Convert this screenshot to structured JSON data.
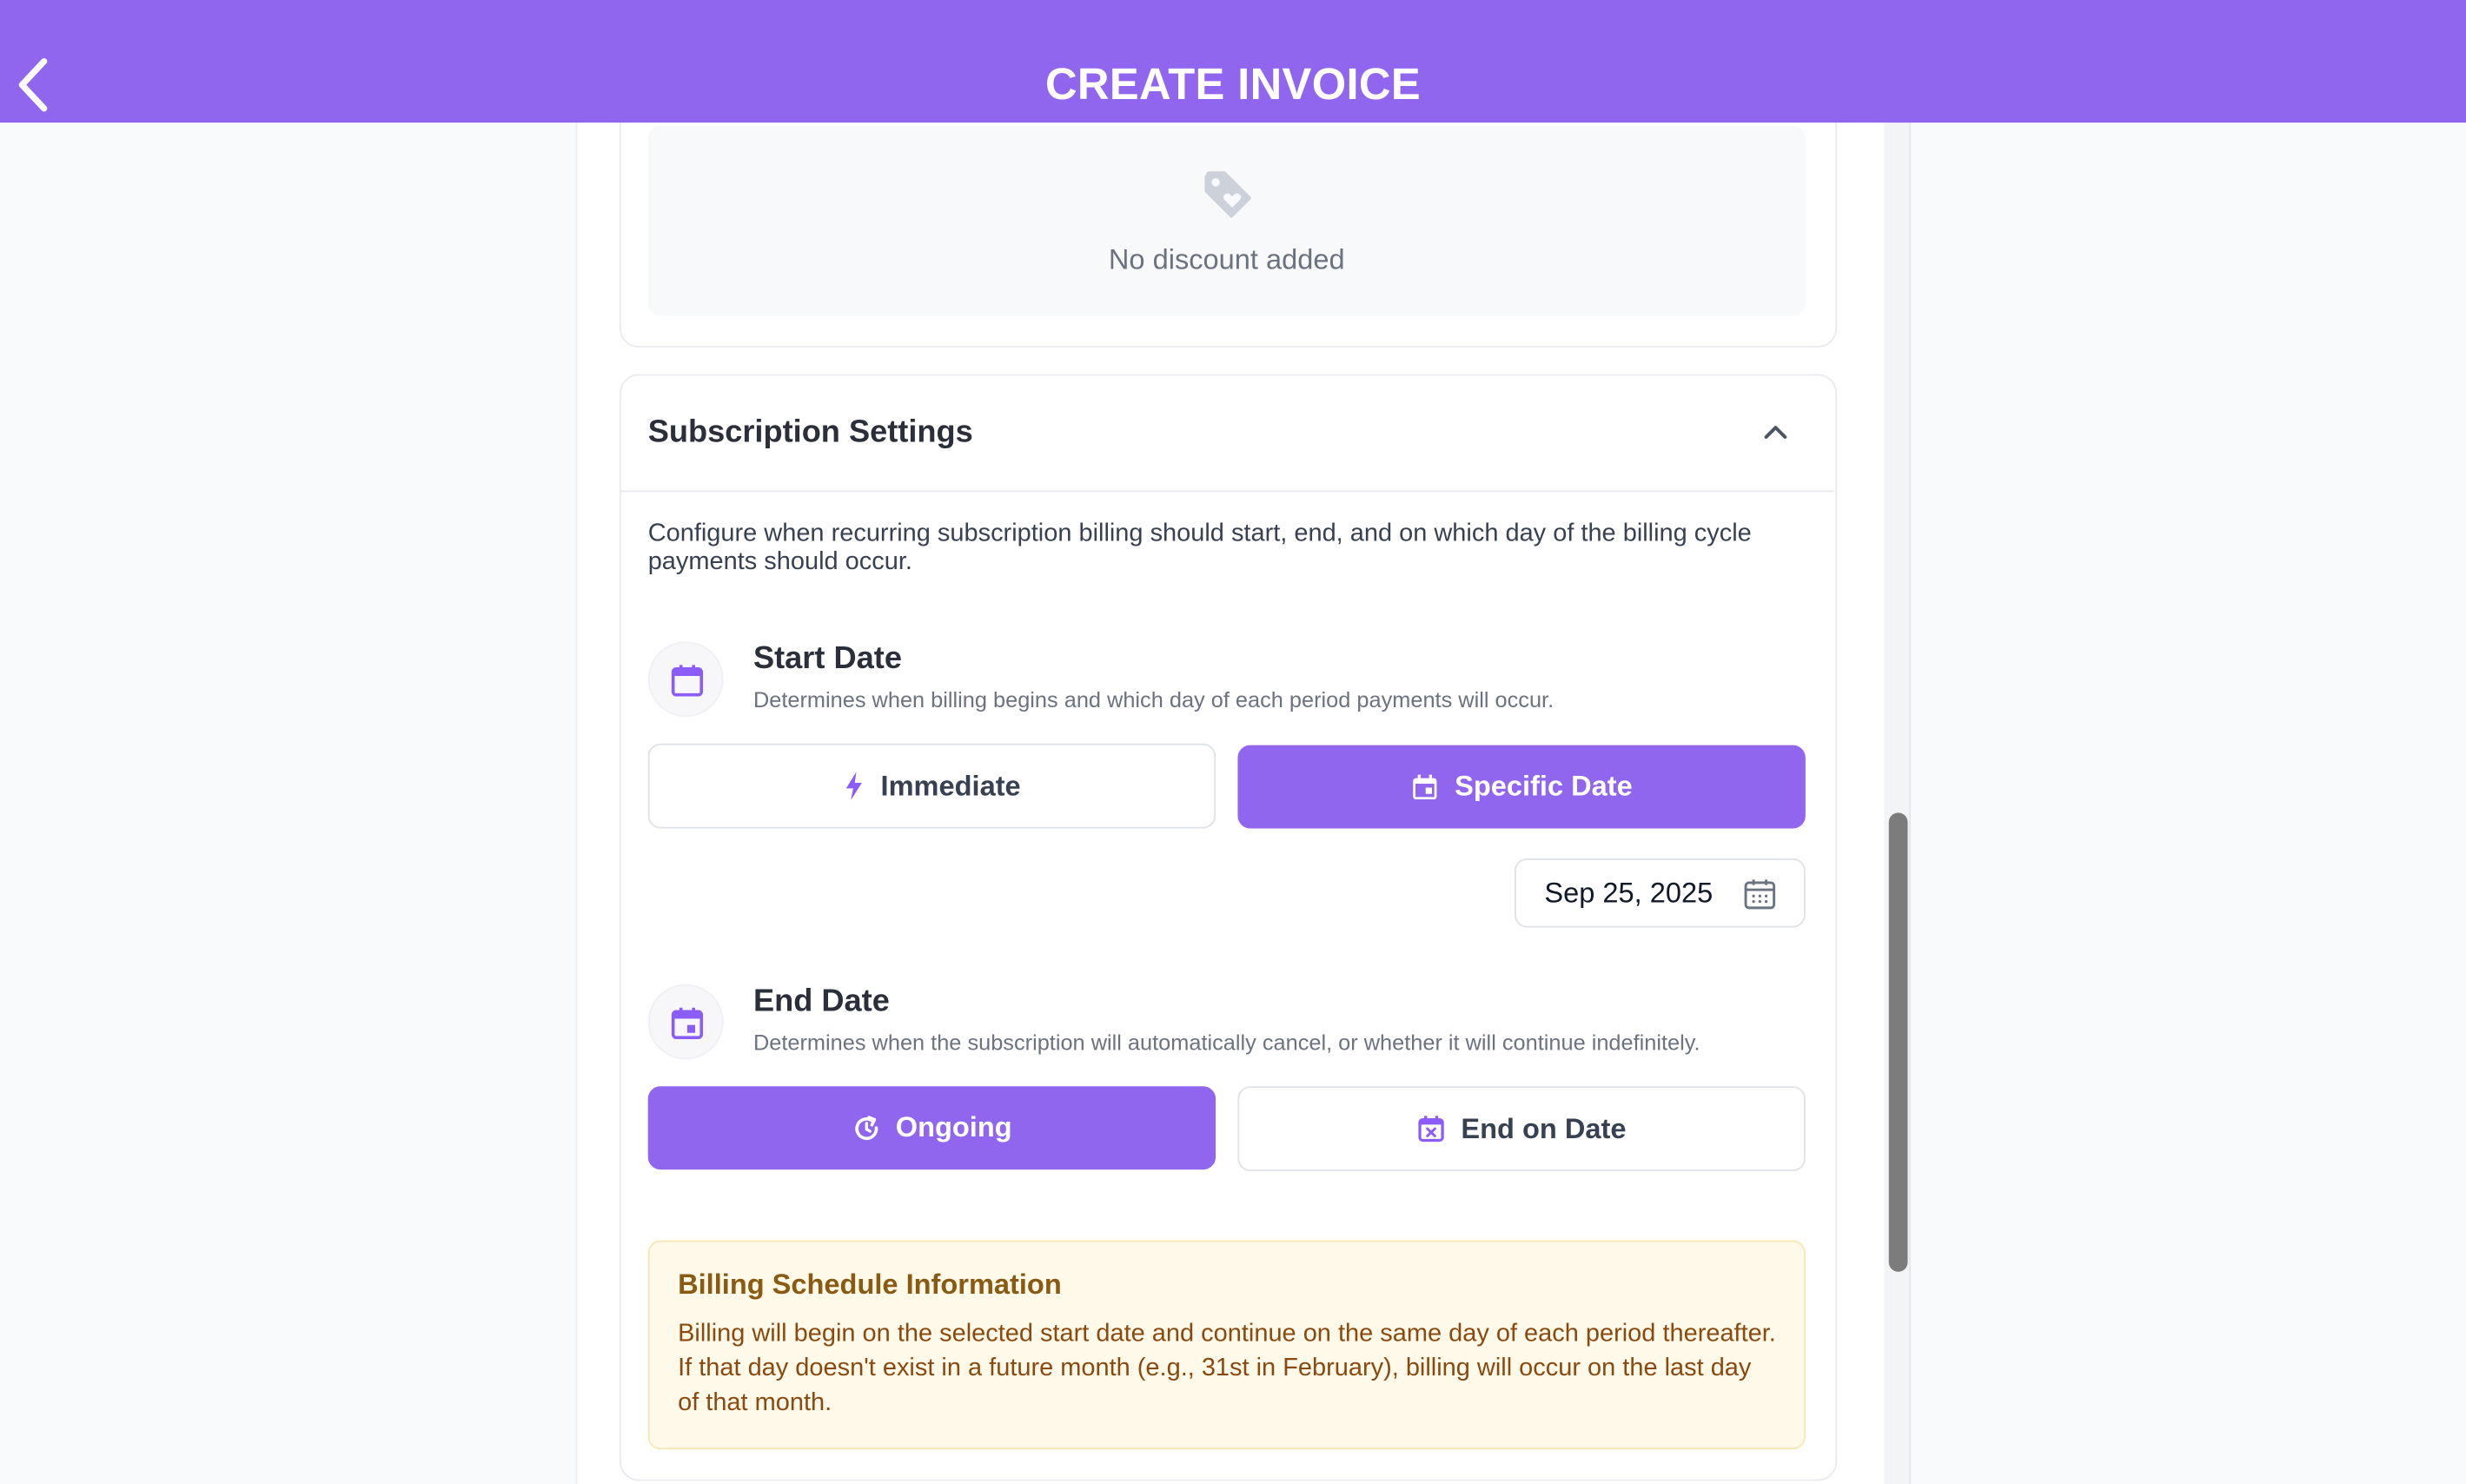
{
  "header": {
    "title": "CREATE INVOICE",
    "back_icon": "chevron-left-icon",
    "background": "#9166ee"
  },
  "discount": {
    "icon": "tag-icon",
    "empty_text": "No discount added"
  },
  "subscription": {
    "title": "Subscription Settings",
    "collapse_icon": "chevron-up-icon",
    "description": "Configure when recurring subscription billing should start, end, and on which day of the billing cycle payments should occur.",
    "start": {
      "title": "Start Date",
      "description": "Determines when billing begins and which day of each period payments will occur.",
      "icon": "calendar-icon",
      "options": [
        {
          "label": "Immediate",
          "icon": "lightning-icon",
          "selected": false
        },
        {
          "label": "Specific Date",
          "icon": "calendar-event-icon",
          "selected": true
        }
      ],
      "date_value": "Sep 25, 2025",
      "date_icon": "calendar-outline-icon"
    },
    "end": {
      "title": "End Date",
      "description": "Determines when the subscription will automatically cancel, or whether it will continue indefinitely.",
      "icon": "calendar-end-icon",
      "options": [
        {
          "label": "Ongoing",
          "icon": "refresh-icon",
          "selected": true
        },
        {
          "label": "End on Date",
          "icon": "calendar-x-icon",
          "selected": false
        }
      ]
    },
    "info": {
      "title": "Billing Schedule Information",
      "text": "Billing will begin on the selected start date and continue on the same day of each period thereafter. If that day doesn't exist in a future month (e.g., 31st in February), billing will occur on the last day of that month."
    }
  },
  "colors": {
    "accent": "#9166ee",
    "info_bg": "#fef9e8",
    "info_title": "#8a5a12",
    "info_text": "#8a4a0f"
  }
}
